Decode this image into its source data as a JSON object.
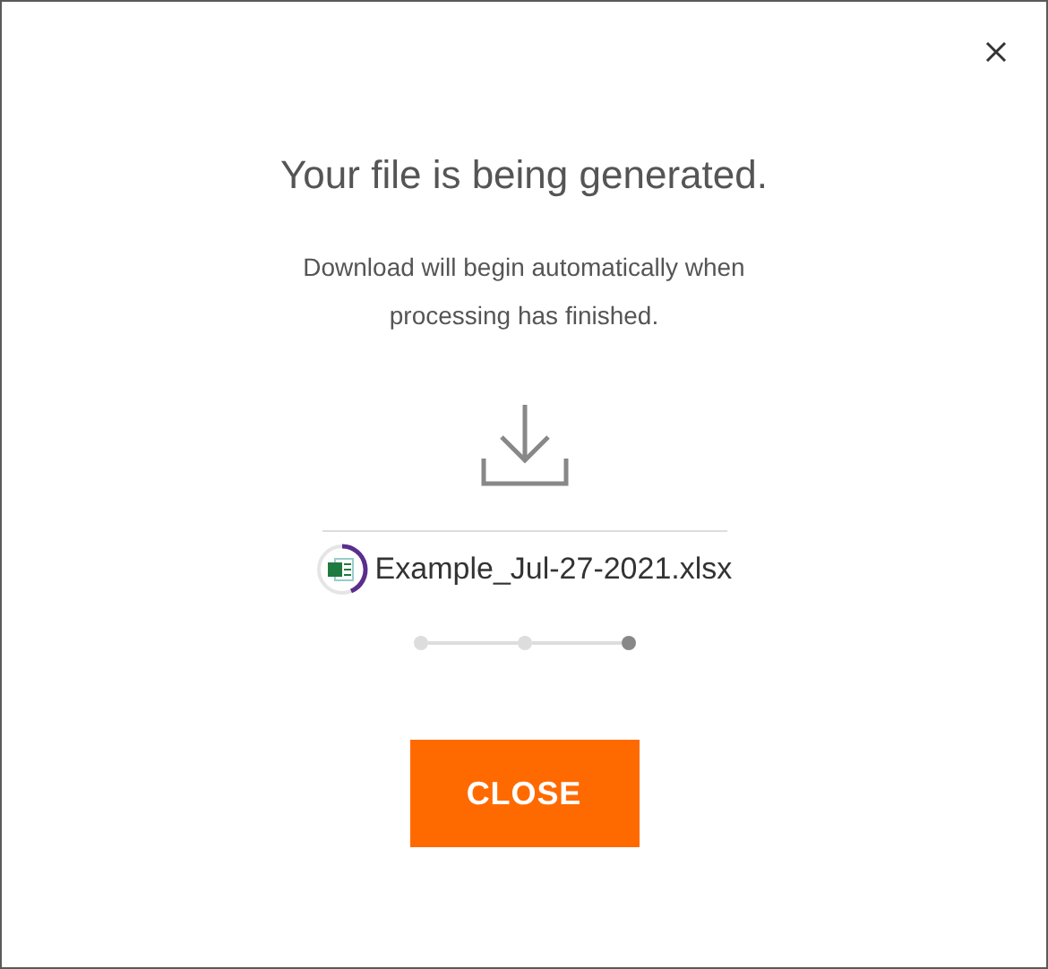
{
  "dialog": {
    "title": "Your file is being generated.",
    "message": "Download will begin automatically when processing has finished.",
    "file": {
      "name": "Example_Jul-27-2021.xlsx"
    },
    "steps": [
      {
        "selected": false
      },
      {
        "selected": false
      },
      {
        "selected": true
      }
    ],
    "button": "CLOSE"
  }
}
